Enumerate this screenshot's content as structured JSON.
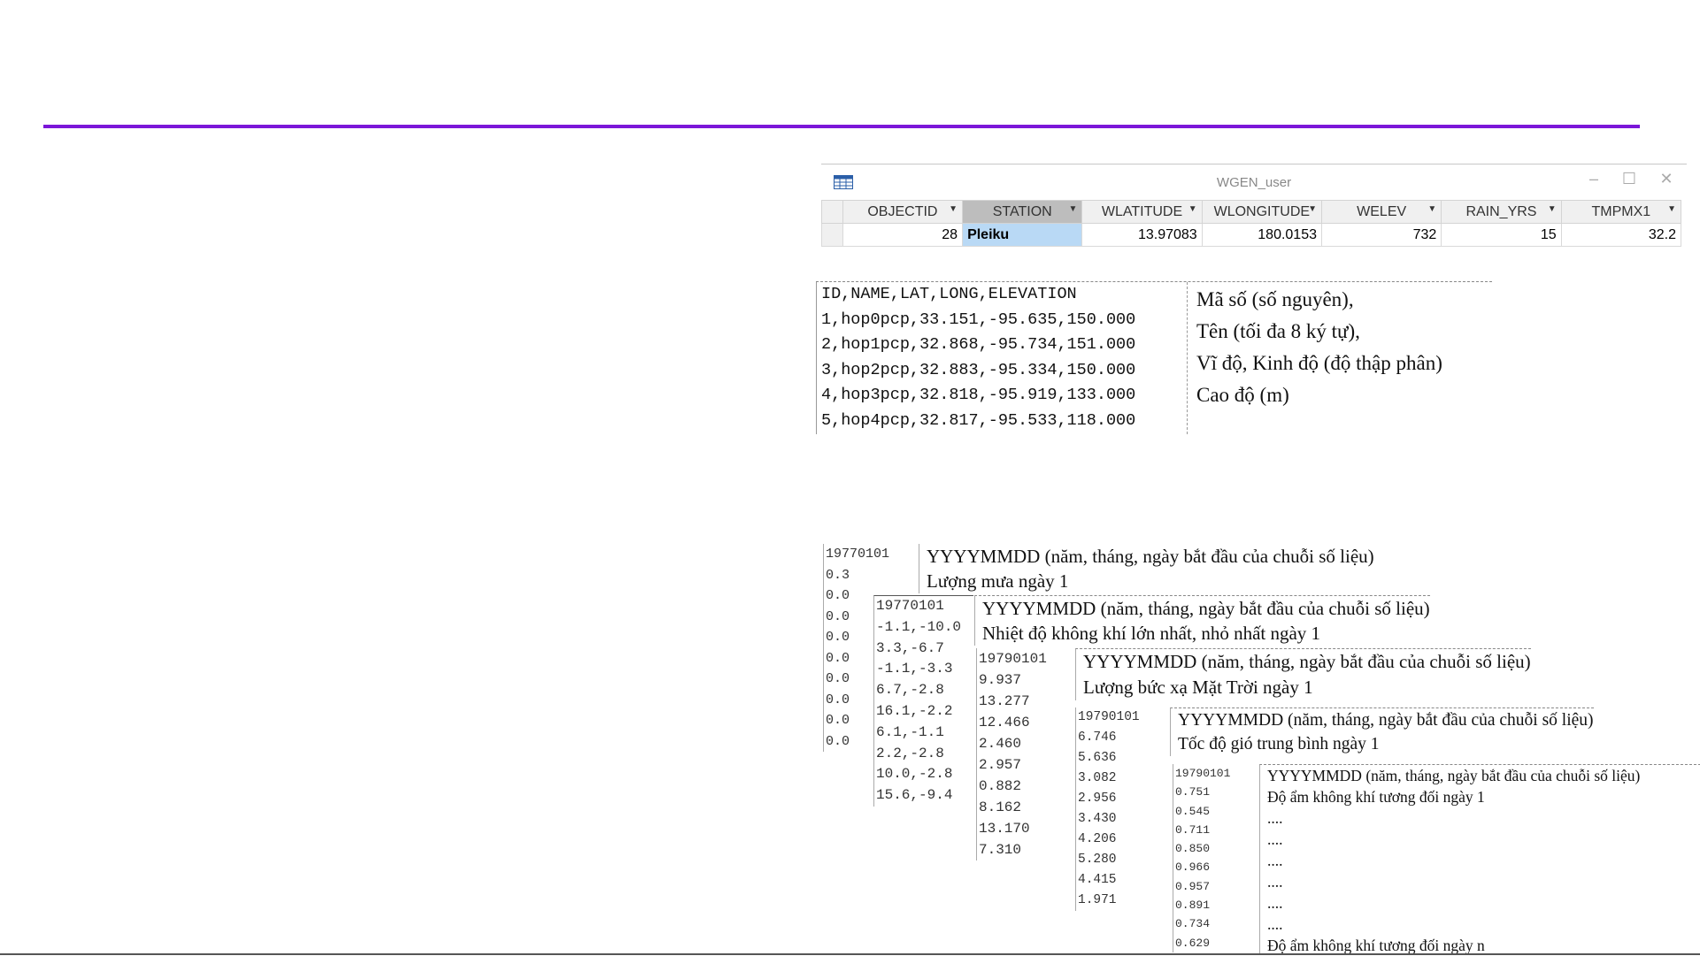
{
  "accent_color": "#7b16d8",
  "window": {
    "title": "WGEN_user",
    "icon": "table-icon",
    "columns": [
      "OBJECTID",
      "STATION",
      "WLATITUDE",
      "WLONGITUDE",
      "WELEV",
      "RAIN_YRS",
      "TMPMX1"
    ],
    "row": [
      "28",
      "Pleiku",
      "13.97083",
      "180.0153",
      "732",
      "15",
      "32.2"
    ]
  },
  "station_file": {
    "lines": [
      "ID,NAME,LAT,LONG,ELEVATION",
      "1,hop0pcp,33.151,-95.635,150.000",
      "2,hop1pcp,32.868,-95.734,151.000",
      "3,hop2pcp,32.883,-95.334,150.000",
      "4,hop3pcp,32.818,-95.919,133.000",
      "5,hop4pcp,32.817,-95.533,118.000"
    ],
    "descriptions": [
      "Mã số (số nguyên),",
      "Tên (tối đa 8 ký tự),",
      "Vĩ độ, Kinh độ (độ thập phân)",
      "Cao độ (m)"
    ]
  },
  "rain": {
    "values": [
      "19770101",
      "0.3",
      "0.0",
      "0.0",
      "0.0",
      "0.0",
      "0.0",
      "0.0",
      "0.0",
      "0.0"
    ],
    "desc": [
      "YYYYMMDD (năm, tháng, ngày bắt đầu của chuỗi số liệu)",
      "Lượng mưa ngày 1"
    ]
  },
  "temp": {
    "values": [
      "19770101",
      "-1.1,-10.0",
      "3.3,-6.7",
      "-1.1,-3.3",
      "6.7,-2.8",
      "16.1,-2.2",
      "6.1,-1.1",
      "2.2,-2.8",
      "10.0,-2.8",
      "15.6,-9.4"
    ],
    "desc": [
      "YYYYMMDD (năm, tháng, ngày bắt đầu của chuỗi số liệu)",
      "Nhiệt độ không khí lớn nhất, nhỏ nhất ngày 1"
    ]
  },
  "solar": {
    "values": [
      "19790101",
      "9.937",
      "13.277",
      "12.466",
      "2.460",
      "2.957",
      "0.882",
      "8.162",
      "13.170",
      "7.310"
    ],
    "desc": [
      "YYYYMMDD (năm, tháng, ngày bắt đầu của chuỗi số liệu)",
      "Lượng bức xạ Mặt Trời ngày 1"
    ]
  },
  "wind": {
    "values": [
      "19790101",
      "6.746",
      "5.636",
      "3.082",
      "2.956",
      "3.430",
      "4.206",
      "5.280",
      "4.415",
      "1.971"
    ],
    "desc": [
      "YYYYMMDD (năm, tháng, ngày bắt đầu của chuỗi số liệu)",
      "Tốc độ gió trung bình ngày 1"
    ]
  },
  "humidity": {
    "values": [
      "19790101",
      "0.751",
      "0.545",
      "0.711",
      "0.850",
      "0.966",
      "0.957",
      "0.891",
      "0.734",
      "0.629"
    ],
    "desc": [
      "YYYYMMDD (năm, tháng, ngày bắt đầu của chuỗi số liệu)",
      "Độ ẩm không khí tương đối ngày 1",
      "....",
      "....",
      "....",
      "....",
      "....",
      "....",
      "Độ ẩm không khí tương đối ngày n"
    ]
  }
}
